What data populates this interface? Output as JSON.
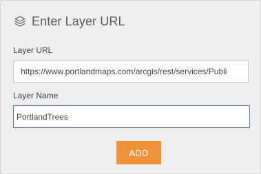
{
  "header": {
    "icon": "layers-icon",
    "title": "Enter Layer URL"
  },
  "form": {
    "url_label": "Layer URL",
    "url_value": "https://www.portlandmaps.com/arcgis/rest/services/Publi",
    "name_label": "Layer Name",
    "name_value": "PortlandTrees",
    "add_label": "ADD"
  },
  "colors": {
    "accent": "#f0923a",
    "panel_bg": "#efefef",
    "focus_border": "#5b7fb0"
  }
}
